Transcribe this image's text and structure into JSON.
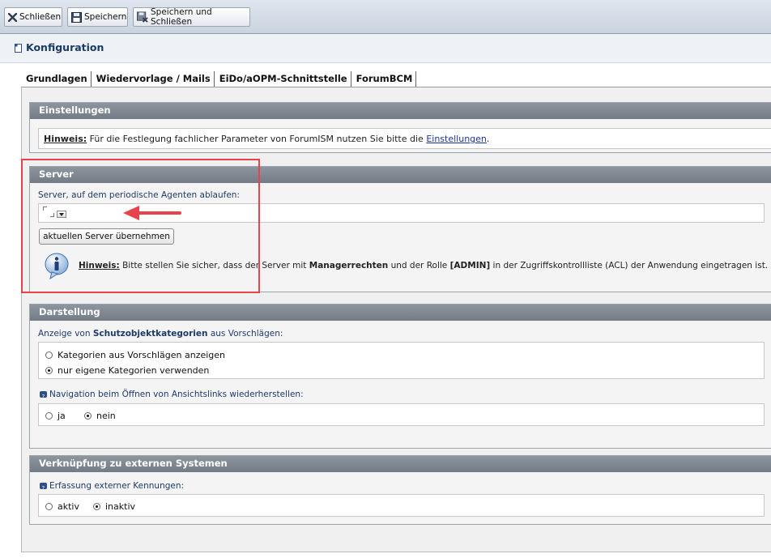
{
  "toolbar": {
    "close_label": "Schließen",
    "save_label": "Speichern",
    "save_close_label": "Speichern und Schließen"
  },
  "header": {
    "title": "Konfiguration"
  },
  "tabs": [
    {
      "label": "Grundlagen"
    },
    {
      "label": "Wiedervorlage / Mails"
    },
    {
      "label": "EiDo/aOPM-Schnittstelle"
    },
    {
      "label": "ForumBCM"
    }
  ],
  "einstellungen": {
    "title": "Einstellungen",
    "hint_label": "Hinweis:",
    "hint_text": "Für die Festlegung fachlicher Parameter von ForumISM nutzen Sie bitte die",
    "hint_link": "Einstellungen",
    "hint_end": "."
  },
  "server": {
    "title": "Server",
    "field_label": "Server, auf dem periodische Agenten ablaufen:",
    "field_value": "",
    "button_label": "aktuellen Server übernehmen",
    "hint_label": "Hinweis:",
    "hint_part1": "Bitte stellen Sie sicher, dass der Server mit",
    "hint_bold1": "Managerrechten",
    "hint_part2": "und der Rolle",
    "hint_bold2": "[ADMIN]",
    "hint_part3": "in der Zugriffskontrollliste (ACL) der Anwendung eingetragen ist."
  },
  "darstellung": {
    "title": "Darstellung",
    "label_prefix": "Anzeige von",
    "label_bold": "Schutzobjektkategorien",
    "label_suffix": "aus Vorschlägen:",
    "option1": "Kategorien aus Vorschlägen anzeigen",
    "option2": "nur eigene Kategorien verwenden",
    "nav_label": "Navigation beim Öffnen von Ansichtslinks wiederherstellen:",
    "nav_yes": "ja",
    "nav_no": "nein"
  },
  "extern": {
    "title": "Verknüpfung zu externen Systemen",
    "label": "Erfassung externer Kennungen:",
    "active": "aktiv",
    "inactive": "inaktiv"
  },
  "colors": {
    "annotation_frame": "#e8434a",
    "annotation_arrow": "#e8434a"
  }
}
